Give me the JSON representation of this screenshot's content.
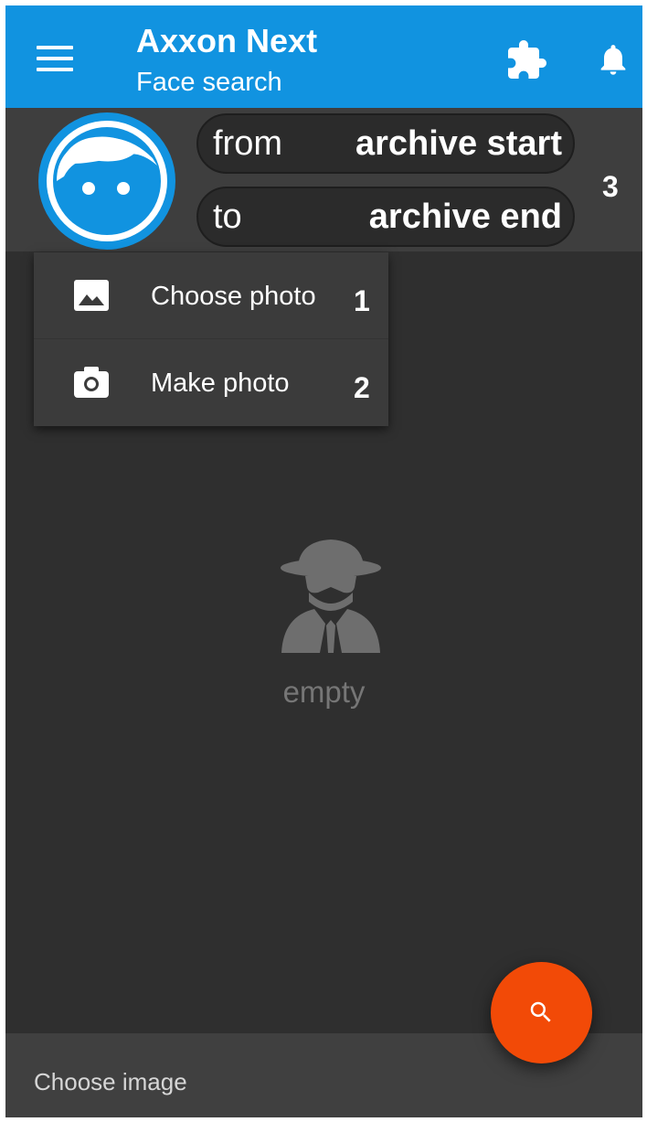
{
  "app_bar": {
    "title": "Axxon Next",
    "subtitle": "Face search",
    "background_color": "#1193e0",
    "icons": [
      "menu-icon",
      "puzzle-icon",
      "bell-icon"
    ]
  },
  "search_bar": {
    "avatar_icon": "face-icon",
    "from_prefix": "from",
    "from_value": "archive start",
    "to_prefix": "to",
    "to_value": "archive end",
    "callout_number": "3"
  },
  "photo_menu": {
    "items": [
      {
        "label": "Choose photo",
        "icon": "image-icon",
        "callout_number": "1"
      },
      {
        "label": "Make photo",
        "icon": "camera-icon",
        "callout_number": "2"
      }
    ]
  },
  "empty_state": {
    "icon": "incognito-spy-icon",
    "label": "empty"
  },
  "fab": {
    "icon": "search-icon",
    "color": "#f24a07"
  },
  "bottom_bar": {
    "label": "Choose image"
  }
}
